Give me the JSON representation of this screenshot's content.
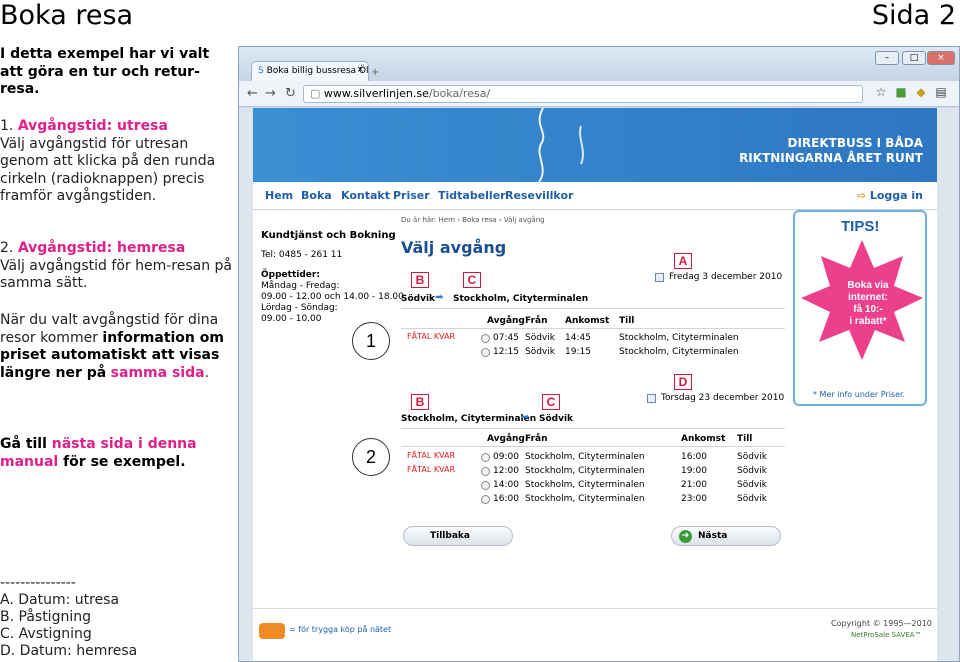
{
  "slide": {
    "title": "Boka resa",
    "page": "Sida 2"
  },
  "left": {
    "intro": "I detta exempel har vi valt att göra en tur och retur-resa.",
    "step1_num": "1.",
    "step1_title": "Avgångstid: utresa",
    "step1_body": "Välj avgångstid för utresan genom att klicka på den runda cirkeln (radioknappen) precis framför avgångstiden.",
    "step2_num": "2.",
    "step2_title": "Avgångstid: hemresa",
    "step2_body": "Välj avgångstid för hem-resan på samma sätt.",
    "p3_a": "När du valt avgångstid för dina resor kommer",
    "p3_b": "information om priset automatiskt att visas längre ner på",
    "p3_c": "samma sida",
    "p3_d": ".",
    "next_a": "Gå till",
    "next_b": "nästa sida i denna manual",
    "next_c": "för se exempel.",
    "divider": "---------------",
    "legend": [
      "A. Datum: utresa",
      "B. Påstigning",
      "C. Avstigning",
      "D. Datum: hemresa"
    ]
  },
  "browser": {
    "tab_title": "Boka billig bussresa Ölan...",
    "url_host": "www.silverlinjen.se",
    "url_path": "/boka/resa/"
  },
  "site": {
    "banner": [
      "DIREKTBUSS I BÅDA",
      "RIKTNINGARNA ÅRET RUNT"
    ],
    "menu": [
      "Hem",
      "Boka",
      "Kontakt",
      "Priser",
      "Tidtabeller",
      "Resevillkor"
    ],
    "login": "Logga in",
    "sidebar": {
      "title": "Kundtjänst och Bokning",
      "phone": "Tel: 0485 - 261 11",
      "hours_title": "Öppettider:",
      "hours": [
        "Måndag - Fredag:",
        "09.00 - 12.00 och 14.00 - 18.00",
        "Lördag - Söndag:",
        "09.00 - 10.00"
      ]
    },
    "breadcrumb": "Du är här: Hem › Boka resa › Välj avgång",
    "heading": "Välj avgång",
    "outbound": {
      "date": "Fredag 3 december 2010",
      "from": "Södvik",
      "to": "Stockholm, Cityterminalen",
      "headers": [
        "Avgång",
        "Från",
        "Ankomst",
        "Till"
      ],
      "alert": "FÅTAL KVAR",
      "rows": [
        {
          "dep": "07:45",
          "from": "Södvik",
          "arr": "14:45",
          "to": "Stockholm, Cityterminalen"
        },
        {
          "dep": "12:15",
          "from": "Södvik",
          "arr": "19:15",
          "to": "Stockholm, Cityterminalen"
        }
      ]
    },
    "return": {
      "date": "Torsdag 23 december 2010",
      "from": "Stockholm, Cityterminalen",
      "to": "Södvik",
      "headers": [
        "Avgång",
        "Från",
        "Ankomst",
        "Till"
      ],
      "alerts": [
        "FÅTAL KVAR",
        "FÅTAL KVAR"
      ],
      "rows": [
        {
          "dep": "09:00",
          "from": "Stockholm, Cityterminalen",
          "arr": "16:00",
          "to": "Södvik"
        },
        {
          "dep": "12:00",
          "from": "Stockholm, Cityterminalen",
          "arr": "19:00",
          "to": "Södvik"
        },
        {
          "dep": "14:00",
          "from": "Stockholm, Cityterminalen",
          "arr": "21:00",
          "to": "Södvik"
        },
        {
          "dep": "16:00",
          "from": "Stockholm, Cityterminalen",
          "arr": "23:00",
          "to": "Södvik"
        }
      ]
    },
    "back_button": "Tillbaka",
    "next_button": "Nästa",
    "tips": {
      "title": "TIPS!",
      "body": [
        "Boka via",
        "internet:",
        "få 10:-",
        "i rabatt*"
      ],
      "more": "* Mer info under Priser."
    },
    "footer_secure": "= för trygga köp på nätet",
    "copyright": "Copyright © 1995—2010",
    "powered": "NetProSale SAVEA™"
  },
  "markers": {
    "A": "A",
    "B": "B",
    "C": "C",
    "D": "D",
    "one": "1",
    "two": "2"
  },
  "colors": {
    "accent_pink": "#e0208a",
    "marker_red": "#d01a3c",
    "link_blue": "#1f5fa8",
    "banner_blue": "#2e76c1"
  }
}
